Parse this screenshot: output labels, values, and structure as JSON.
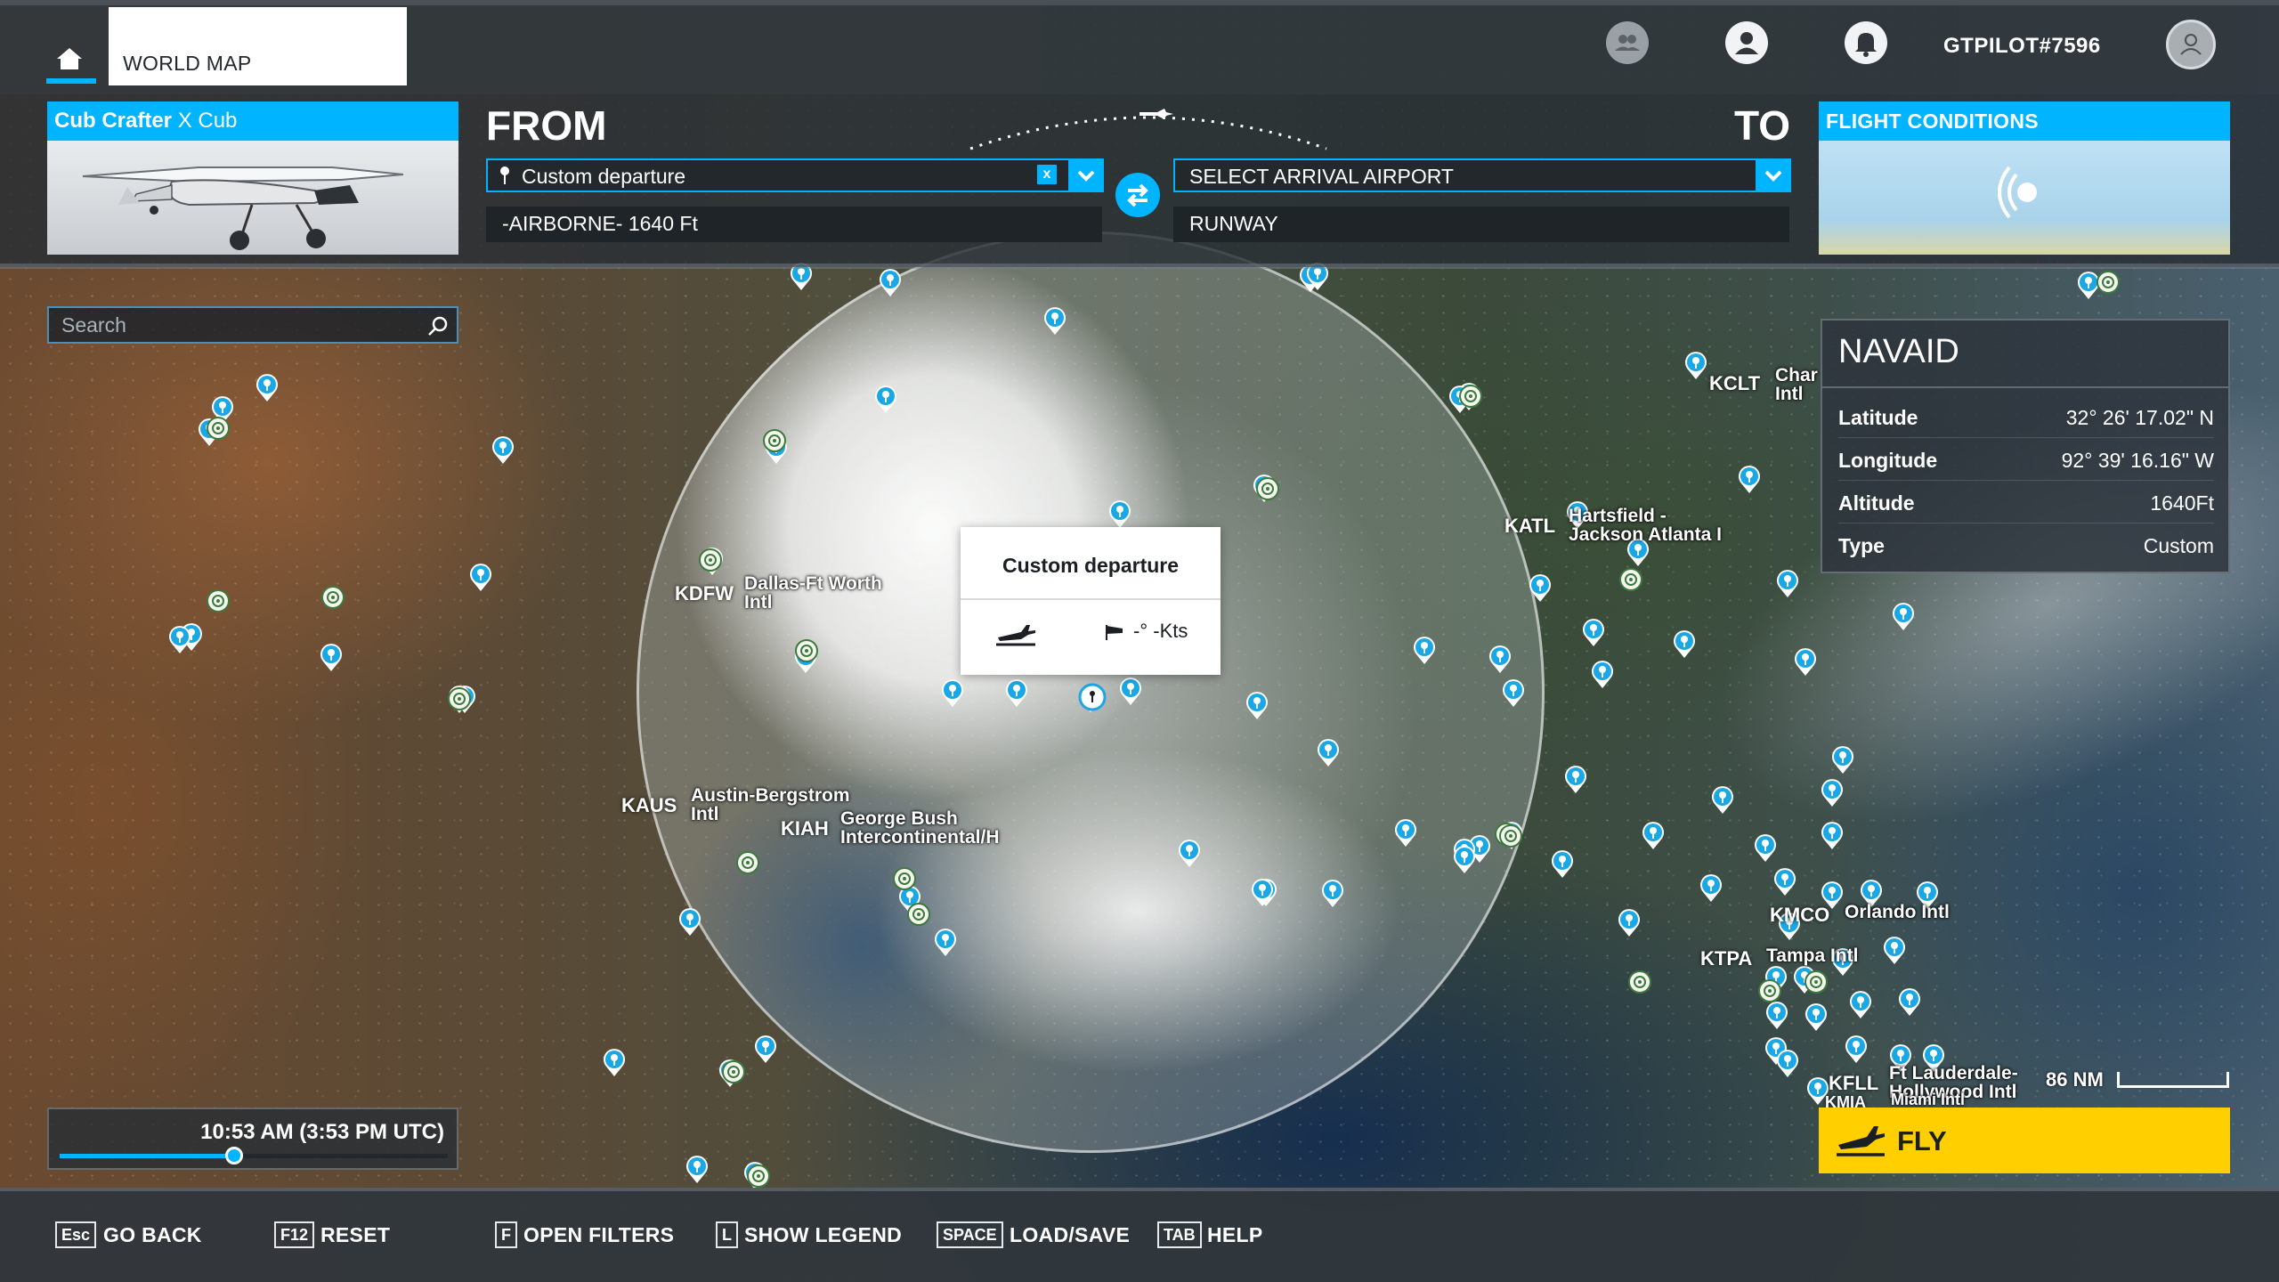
{
  "topbar": {
    "tab_label": "WORLD MAP",
    "username": "GTPILOT#7596",
    "icons": [
      "home-icon",
      "friends-icon",
      "profile-icon",
      "notification-icon",
      "avatar-icon"
    ]
  },
  "aircraft": {
    "brand": "Cub Crafter",
    "model": "X Cub"
  },
  "route": {
    "from_label": "FROM",
    "to_label": "TO",
    "departure_value": "Custom departure",
    "departure_clear": "x",
    "departure_detail": "-AIRBORNE- 1640 Ft",
    "arrival_placeholder": "SELECT ARRIVAL AIRPORT",
    "arrival_detail": "RUNWAY"
  },
  "conditions": {
    "title": "FLIGHT CONDITIONS"
  },
  "search": {
    "placeholder": "Search",
    "value": ""
  },
  "navaid": {
    "title": "NAVAID",
    "rows": [
      {
        "key": "Latitude",
        "value": "32° 26' 17.02\" N"
      },
      {
        "key": "Longitude",
        "value": "92° 39' 16.16\" W"
      },
      {
        "key": "Altitude",
        "value": "1640Ft"
      },
      {
        "key": "Type",
        "value": "Custom"
      }
    ]
  },
  "popup": {
    "title": "Custom departure",
    "wind": "-° -Kts"
  },
  "map": {
    "airports": [
      {
        "code": "KCLT",
        "name": "Char\nIntl"
      },
      {
        "code": "KATL",
        "name": "Hartsfield -\nJackson Atlanta I"
      },
      {
        "code": "KDFW",
        "name": "Dallas-Ft Worth\nIntl"
      },
      {
        "code": "KAUS",
        "name": "Austin-Bergstrom\nIntl"
      },
      {
        "code": "KIAH",
        "name": "George Bush\nIntercontinental/H"
      },
      {
        "code": "KMCO",
        "name": "Orlando Intl"
      },
      {
        "code": "KTPA",
        "name": "Tampa Intl"
      },
      {
        "code": "KFLL",
        "name": "Ft Lauderdale-\nHollywood Intl"
      },
      {
        "code": "KMIA",
        "name": "Miami Intl"
      }
    ],
    "scale": "86 NM"
  },
  "time": {
    "display": "10:53 AM (3:53 PM UTC)",
    "progress": 0.45
  },
  "fly": {
    "label": "FLY"
  },
  "bottombar": {
    "hints": [
      {
        "key": "Esc",
        "label": "GO BACK"
      },
      {
        "key": "F12",
        "label": "RESET"
      },
      {
        "key": "F",
        "label": "OPEN FILTERS"
      },
      {
        "key": "L",
        "label": "SHOW LEGEND"
      },
      {
        "key": "SPACE",
        "label": "LOAD/SAVE"
      },
      {
        "key": "TAB",
        "label": "HELP"
      }
    ]
  },
  "colors": {
    "accent": "#00b4ff",
    "fly": "#ffcf00",
    "panel": "#30363c"
  }
}
